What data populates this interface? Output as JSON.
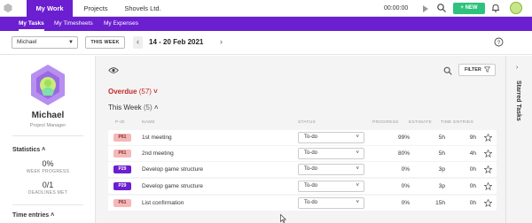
{
  "topbar": {
    "tabs": [
      "My Work",
      "Projects",
      "Shovels Ltd."
    ],
    "timer": "00:00:00",
    "new_label": "+ NEW"
  },
  "subnav": {
    "tabs": [
      "My Tasks",
      "My Timesheets",
      "My Expenses"
    ]
  },
  "toolbar": {
    "user": "Michael",
    "this_week": "THIS WEEK",
    "date_range": "14 - 20 Feb 2021"
  },
  "profile": {
    "name": "Michael",
    "role": "Project Manager"
  },
  "statistics": {
    "title": "Statistics",
    "week_progress": "0%",
    "week_progress_label": "WEEK PROGRESS",
    "deadlines": "0/1",
    "deadlines_label": "DEADLINES MET"
  },
  "time_entries": {
    "title": "Time entries"
  },
  "main": {
    "filter_label": "FILTER",
    "overdue_label": "Overdue",
    "overdue_count": "(57)",
    "section_label": "This Week",
    "section_count": "(5)",
    "columns": {
      "pid": "P-ID",
      "name": "NAME",
      "status": "STATUS",
      "progress": "PROGRESS",
      "estimate": "ESTIMATE",
      "time": "TIME ENTRIES"
    },
    "rows": [
      {
        "pid": "P61",
        "name": "1st meeting",
        "status": "To-do",
        "progress": "99%",
        "estimate": "5h",
        "time": "9h"
      },
      {
        "pid": "P61",
        "name": "2nd meeting",
        "status": "To-do",
        "progress": "80%",
        "estimate": "5h",
        "time": "4h"
      },
      {
        "pid": "P29",
        "name": "Develop game structure",
        "status": "To-do",
        "progress": "0%",
        "estimate": "3p",
        "time": "0h"
      },
      {
        "pid": "P29",
        "name": "Develop game structure",
        "status": "To-do",
        "progress": "0%",
        "estimate": "3p",
        "time": "0h"
      },
      {
        "pid": "P61",
        "name": "List confirmation",
        "status": "To-do",
        "progress": "0%",
        "estimate": "15h",
        "time": "0h"
      }
    ]
  },
  "starred": {
    "label": "Starred Tasks"
  },
  "colors": {
    "brand": "#6b1fd0",
    "new_button": "#2ec27e",
    "overdue": "#c62828"
  }
}
